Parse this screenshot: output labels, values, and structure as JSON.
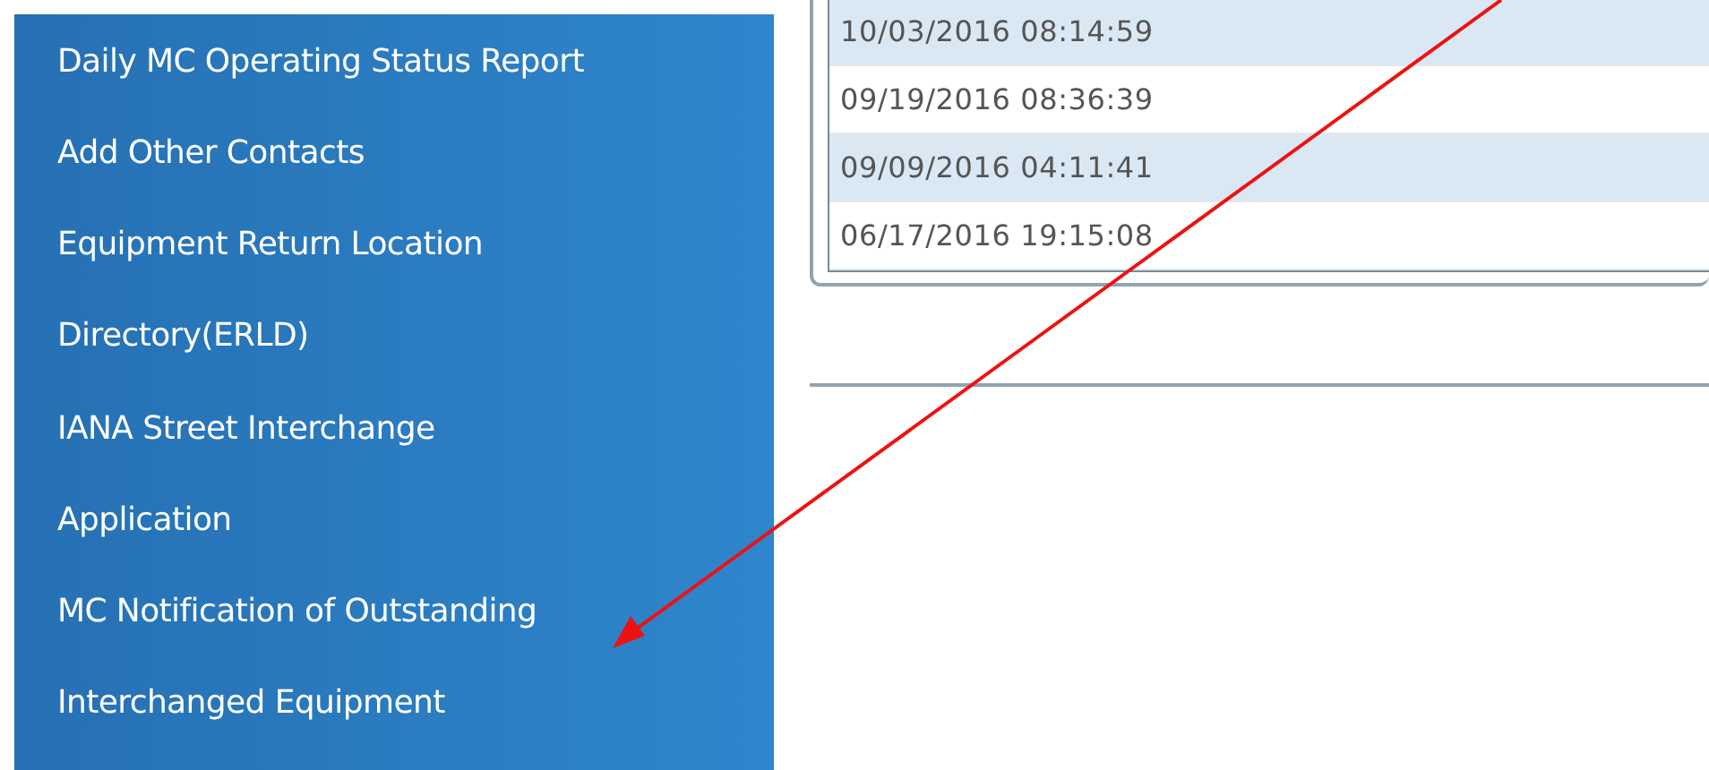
{
  "sidebar": {
    "items": [
      {
        "label": "Daily MC Operating Status Report"
      },
      {
        "label": "Add Other Contacts"
      },
      {
        "label": "Equipment Return Location"
      },
      {
        "label": "Directory(ERLD)"
      },
      {
        "label": "IANA Street Interchange"
      },
      {
        "label": "Application"
      },
      {
        "label": "MC Notification of Outstanding"
      },
      {
        "label": "Interchanged Equipment"
      }
    ]
  },
  "table": {
    "rows": [
      {
        "date": "10/03/2016 08:14:59"
      },
      {
        "date": "09/19/2016 08:36:39"
      },
      {
        "date": "09/09/2016 04:11:41"
      },
      {
        "date": "06/17/2016 19:15:08"
      }
    ]
  }
}
